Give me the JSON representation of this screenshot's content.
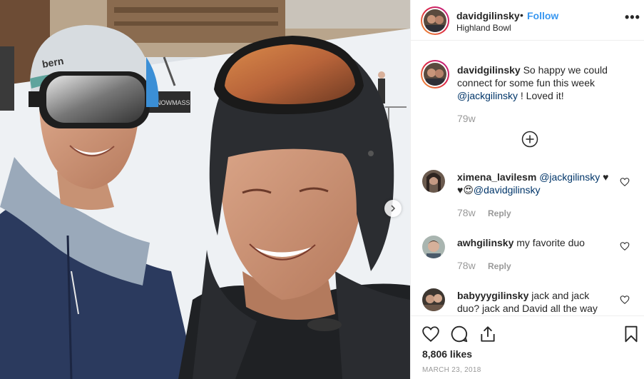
{
  "header": {
    "username": "davidgilinsky",
    "separator": "•",
    "follow_label": "Follow",
    "location": "Highland Bowl",
    "more_label": "•••"
  },
  "caption": {
    "username": "davidgilinsky",
    "text_part1": "So happy we could connect for some fun this week",
    "mention": "@jackgilinsky",
    "text_part2": "! Loved it!",
    "time": "79w"
  },
  "comments": [
    {
      "username": "ximena_lavilesm",
      "mention1": "@jackgilinsky",
      "emoji": "♥ ♥😍",
      "mention2": "@davidgilinsky",
      "time": "78w",
      "reply_label": "Reply"
    },
    {
      "username": "awhgilinsky",
      "text": "my favorite duo",
      "time": "78w",
      "reply_label": "Reply"
    },
    {
      "username": "babyyygilinsky",
      "text": "jack and jack duo? jack and David all the way"
    }
  ],
  "footer": {
    "likes": "8,806 likes",
    "date": "MARCH 23, 2018"
  },
  "photo": {
    "helmet_brand": "bern",
    "sign_text": "SNOWMASS"
  },
  "colors": {
    "link": "#3897f0",
    "mention": "#003569",
    "muted": "#999999",
    "text": "#262626"
  },
  "icons": [
    "more-icon",
    "plus-circle-icon",
    "heart-icon",
    "comment-icon",
    "share-icon",
    "bookmark-icon",
    "chevron-right-icon"
  ]
}
